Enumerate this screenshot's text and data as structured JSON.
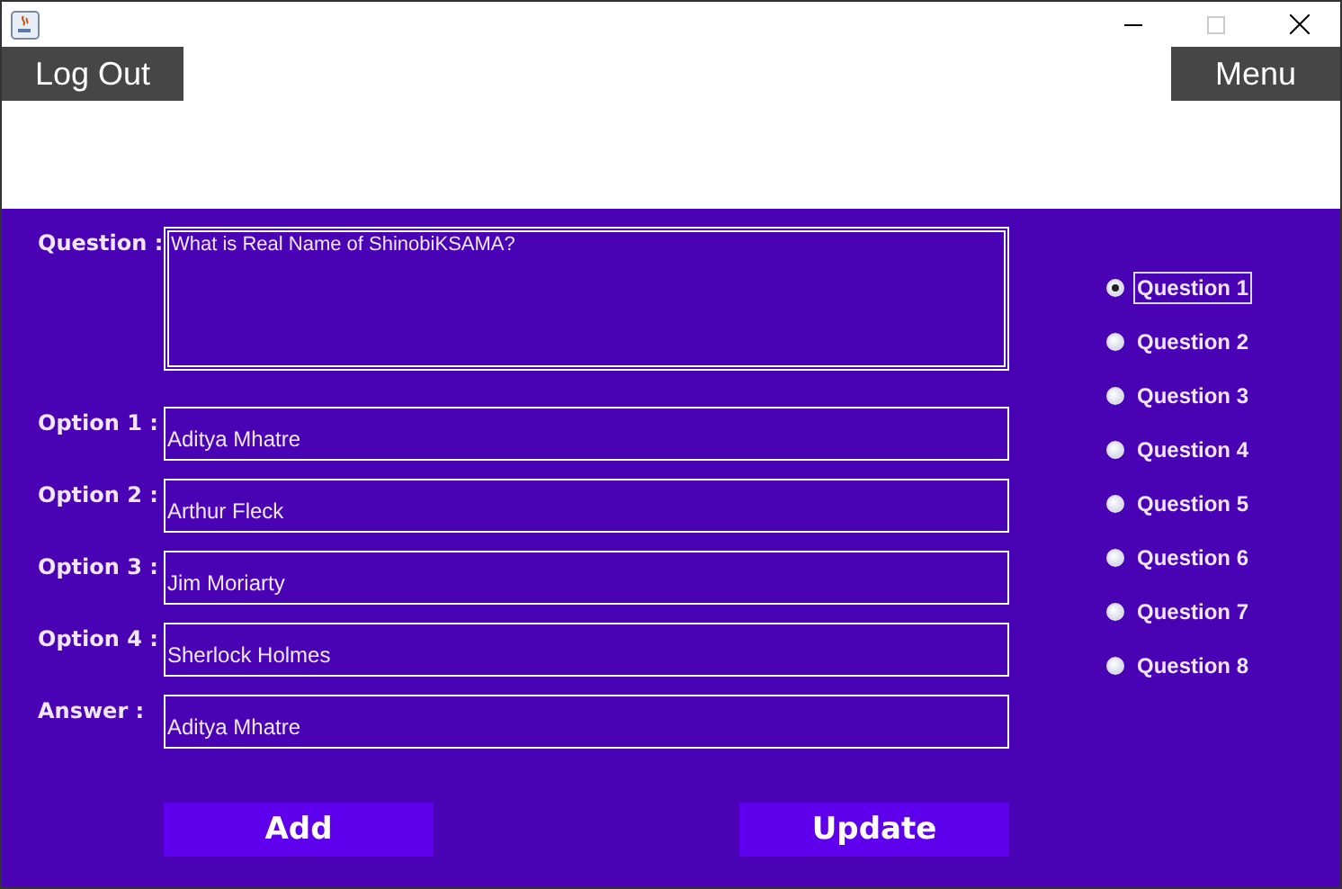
{
  "header": {
    "logout": "Log Out",
    "menu": "Menu"
  },
  "question": {
    "label": "Question :",
    "value": "What is Real Name of ShinobiKSAMA?"
  },
  "fields": [
    {
      "label": "Option 1 :",
      "value": "Aditya Mhatre"
    },
    {
      "label": "Option 2 :",
      "value": "Arthur Fleck"
    },
    {
      "label": "Option 3 :",
      "value": "Jim Moriarty"
    },
    {
      "label": "Option 4 :",
      "value": "Sherlock Holmes"
    },
    {
      "label": "Answer :",
      "value": "Aditya Mhatre"
    }
  ],
  "buttons": [
    "Add",
    "Update"
  ],
  "questions": [
    {
      "label": "Question 1",
      "selected": true
    },
    {
      "label": "Question 2",
      "selected": false
    },
    {
      "label": "Question 3",
      "selected": false
    },
    {
      "label": "Question 4",
      "selected": false
    },
    {
      "label": "Question 5",
      "selected": false
    },
    {
      "label": "Question 6",
      "selected": false
    },
    {
      "label": "Question 7",
      "selected": false
    },
    {
      "label": "Question 8",
      "selected": false
    }
  ]
}
